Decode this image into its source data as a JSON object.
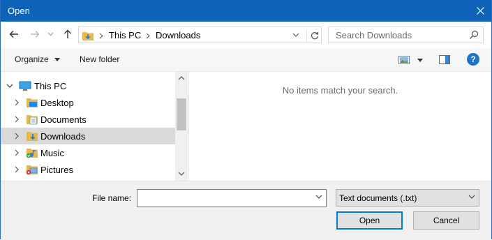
{
  "window": {
    "title": "Open"
  },
  "nav": {
    "breadcrumb": [
      "This PC",
      "Downloads"
    ],
    "search_placeholder": "Search Downloads"
  },
  "toolbar": {
    "organize_label": "Organize",
    "new_folder_label": "New folder",
    "help_label": "?"
  },
  "tree": {
    "items": [
      {
        "label": "This PC",
        "icon": "pc-icon",
        "expanded": true,
        "selected": false
      },
      {
        "label": "Desktop",
        "icon": "desktop-folder-icon",
        "selected": false
      },
      {
        "label": "Documents",
        "icon": "documents-folder-icon",
        "selected": false
      },
      {
        "label": "Downloads",
        "icon": "downloads-folder-icon",
        "selected": true
      },
      {
        "label": "Music",
        "icon": "music-folder-icon",
        "selected": false
      },
      {
        "label": "Pictures",
        "icon": "pictures-folder-icon",
        "selected": false
      }
    ]
  },
  "main": {
    "empty_message": "No items match your search."
  },
  "footer": {
    "file_name_label": "File name:",
    "file_name_value": "",
    "file_type_selected": "Text documents (.txt)",
    "open_label": "Open",
    "cancel_label": "Cancel"
  },
  "colors": {
    "titlebar": "#0e63b8",
    "accent": "#0078d7",
    "selection": "#d9d9d9"
  }
}
